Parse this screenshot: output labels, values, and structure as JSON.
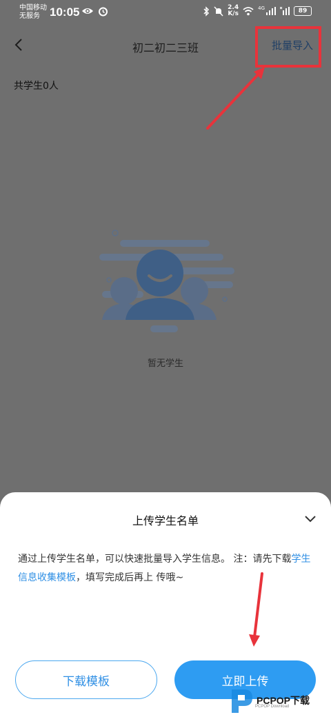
{
  "status_bar": {
    "carrier_line1": "中国移动",
    "carrier_line2": "无服务",
    "time": "10:05",
    "speed_value": "2.4",
    "speed_unit": "K/s",
    "network_4g": "4G",
    "battery": "89"
  },
  "navbar": {
    "title": "初二初二三班",
    "batch_import": "批量导入"
  },
  "content": {
    "student_count": "共学生0人",
    "empty_text": "暂无学生"
  },
  "sheet": {
    "title": "上传学生名单",
    "desc_before": "通过上传学生名单，可以快速批量导入学生信息。 注：请先下载",
    "desc_link": "学生信息收集模板",
    "desc_after": "，填写完成后再上 传哦~",
    "download_button": "下载模板",
    "upload_button": "立即上传"
  },
  "watermark": {
    "text": "PCPOP下载",
    "sub": "PCPOP Download"
  },
  "colors": {
    "overlay": "#6f6f6f",
    "accent": "#2e9cf2",
    "annotation": "#e8333b"
  }
}
